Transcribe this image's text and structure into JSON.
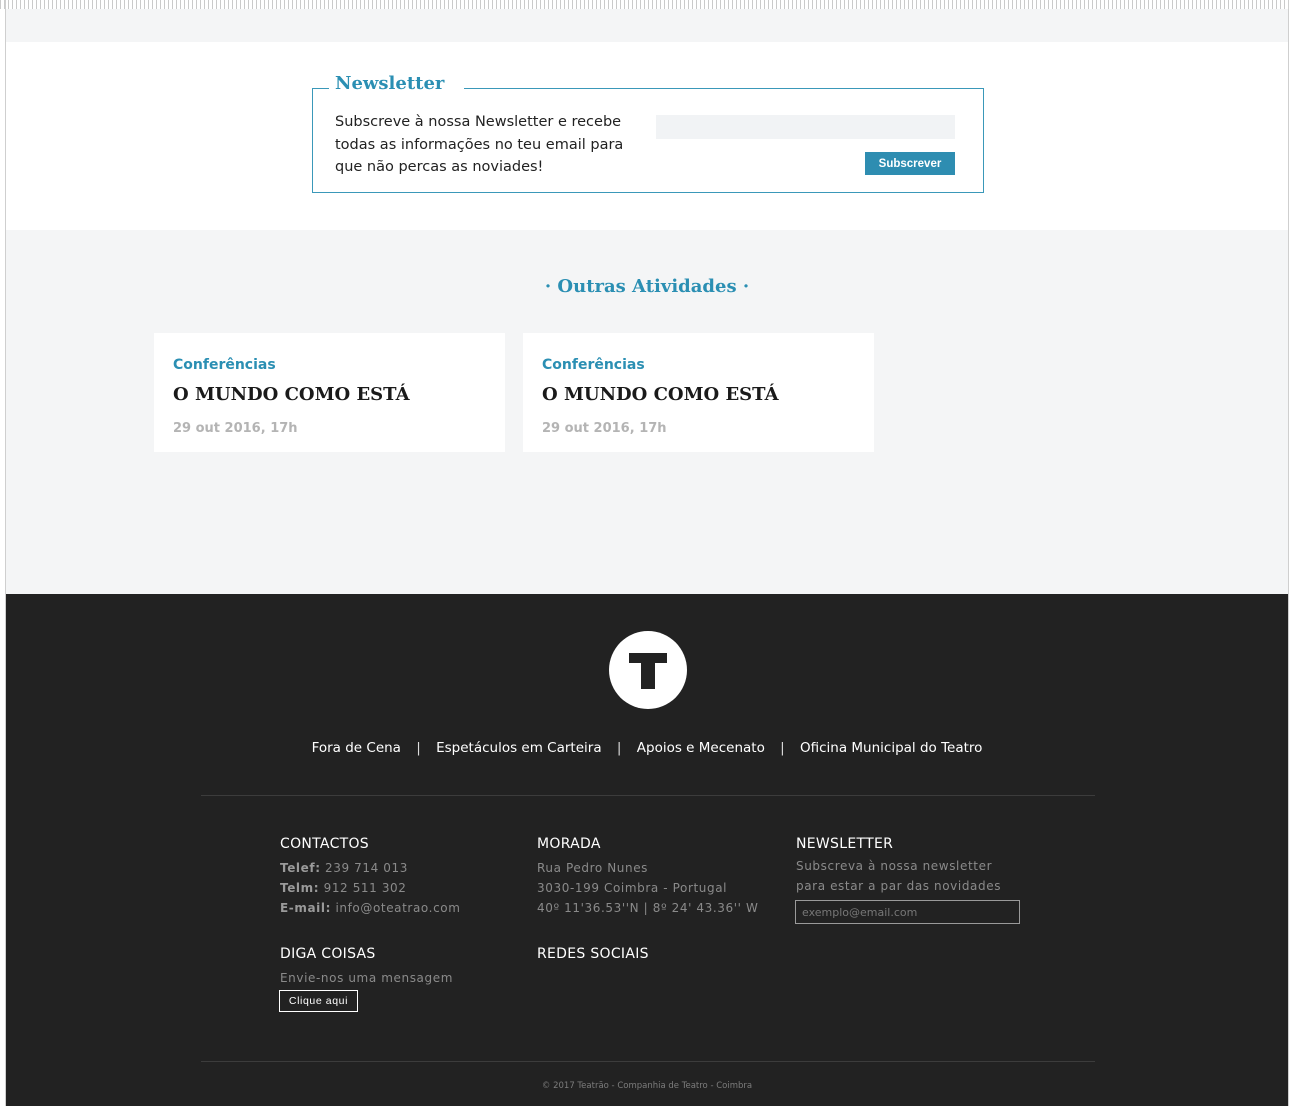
{
  "newsletter": {
    "title": "Newsletter",
    "text": "Subscreve à nossa Newsletter e recebe todas as informações no teu email para que não percas as noviades!",
    "input_placeholder": "",
    "button_label": "Subscrever"
  },
  "others": {
    "title": "· Outras Atividades ·",
    "cards": [
      {
        "category": "Conferências",
        "title": "O MUNDO COMO ESTÁ",
        "date": "29 out 2016, 17h"
      },
      {
        "category": "Conferências",
        "title": "O MUNDO COMO ESTÁ",
        "date": "29 out 2016, 17h"
      }
    ]
  },
  "footer": {
    "logo_letter": "T",
    "nav": [
      "Fora de Cena",
      "Espetáculos em Carteira",
      "Apoios e Mecenato",
      "Oficina Municipal do Teatro"
    ],
    "nav_separator": "|",
    "contactos": {
      "heading": "CONTACTOS",
      "telef_label": "Telef:",
      "telef_value": "239 714 013",
      "telm_label": "Telm:",
      "telm_value": "912 511 302",
      "email_label": "E-mail:",
      "email_value": "info@oteatrao.com"
    },
    "morada": {
      "heading": "MORADA",
      "line1": "Rua Pedro Nunes",
      "line2": "3030-199 Coimbra - Portugal",
      "line3": "40º 11'36.53''N | 8º 24' 43.36'' W"
    },
    "newsletter": {
      "heading": "NEWSLETTER",
      "line1": "Subscreva à nossa newsletter",
      "line2": "para estar a par das novidades",
      "email_placeholder": "exemplo@email.com"
    },
    "diga_coisas": {
      "heading": "DIGA COISAS",
      "text": "Envie-nos uma mensagem",
      "button_label": "Clique aqui"
    },
    "redes_sociais": {
      "heading": "REDES SOCIAIS"
    },
    "copyright": "© 2017 Teatrão - Companhia de Teatro - Coimbra"
  },
  "colors": {
    "accent": "#2b8fb3",
    "footer_bg": "#222222",
    "section_bg": "#f4f5f6"
  }
}
